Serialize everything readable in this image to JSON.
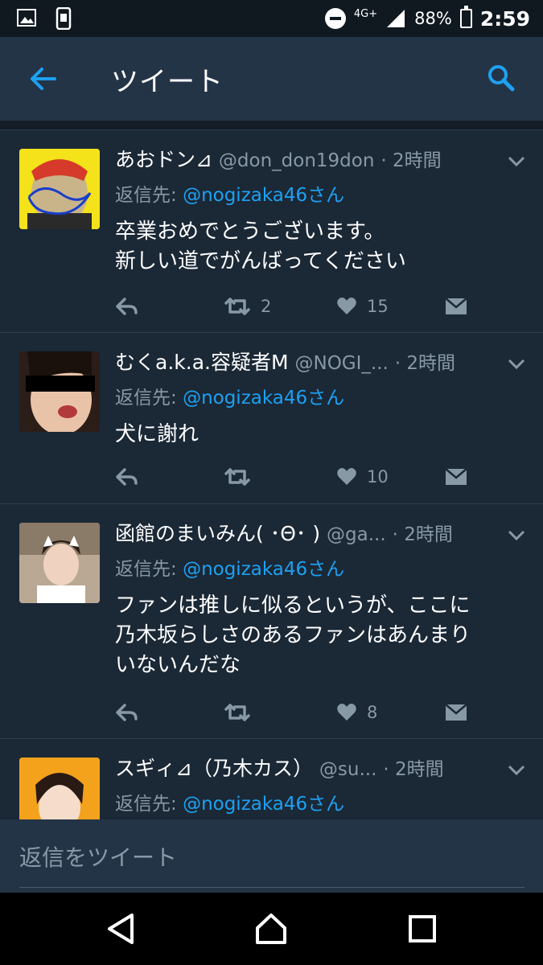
{
  "status_bar": {
    "network": "4G+",
    "battery": "88%",
    "time": "2:59"
  },
  "header": {
    "title": "ツイート"
  },
  "tweets": [
    {
      "name": "あおドン⊿",
      "handle": "@don_don19don",
      "time": "· 2時間",
      "reply_prefix": "返信先: ",
      "reply_to": "@nogizaka46さん",
      "text": "卒業おめでとうございます。\n新しい道でがんばってください",
      "retweets": "2",
      "likes": "15"
    },
    {
      "name": "むくa.k.a.容疑者M",
      "handle": "@NOGI_...",
      "time": "· 2時間",
      "reply_prefix": "返信先: ",
      "reply_to": "@nogizaka46さん",
      "text": "犬に謝れ",
      "retweets": "",
      "likes": "10"
    },
    {
      "name": "函館のまいみん( ･Θ･ )",
      "handle": "@ga...",
      "time": "· 2時間",
      "reply_prefix": "返信先: ",
      "reply_to": "@nogizaka46さん",
      "text": "ファンは推しに似るというが、ここに\n乃木坂らしさのあるファンはあんまり\nいないんだな",
      "retweets": "",
      "likes": "8"
    },
    {
      "name": "スギィ⊿（乃木カス）",
      "handle": "@su...",
      "time": "· 2時間",
      "reply_prefix": "返信先: ",
      "reply_to": "@nogizaka46さん",
      "text": "",
      "retweets": "",
      "likes": ""
    }
  ],
  "composer": {
    "placeholder": "返信をツイート"
  },
  "icons": {
    "back": "arrow-left-icon",
    "search": "search-icon",
    "more": "chevron-down-icon",
    "reply": "reply-icon",
    "retweet": "retweet-icon",
    "like": "heart-icon",
    "dm": "envelope-icon"
  },
  "colors": {
    "accent": "#1da1f2",
    "background": "#141d26",
    "card": "#1b2836",
    "header": "#243447",
    "muted": "#8899a6"
  }
}
